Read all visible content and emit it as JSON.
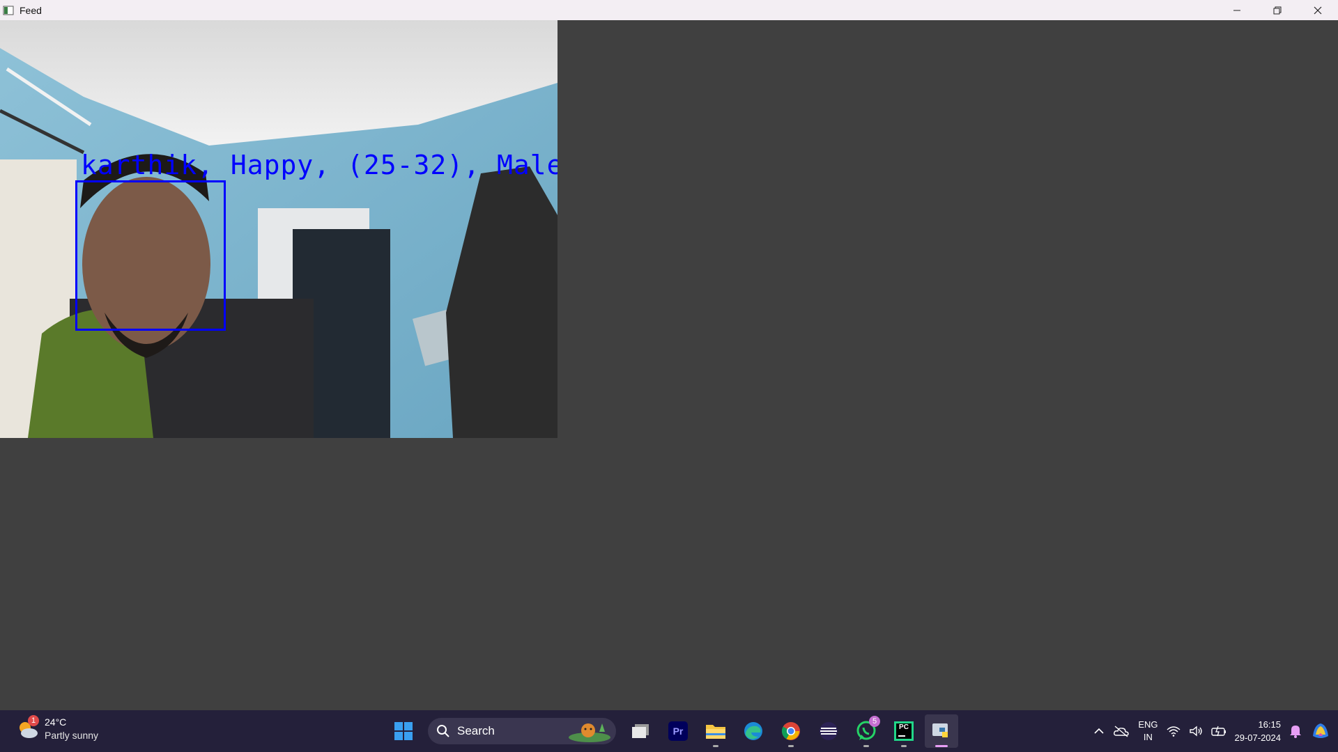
{
  "window": {
    "title": "Feed"
  },
  "feed": {
    "overlay_label": "karthik, Happy, (25-32), Male",
    "box_color": "#0000ff"
  },
  "taskbar": {
    "weather": {
      "temp": "24°C",
      "desc": "Partly sunny",
      "badge": "1"
    },
    "search": {
      "placeholder": "Search"
    },
    "apps": [
      {
        "name": "start-button",
        "icon": "windows-logo-icon"
      },
      {
        "name": "task-view",
        "icon": "task-view-icon"
      },
      {
        "name": "premiere-pro",
        "icon": "premiere-pro-icon",
        "label": "Pr"
      },
      {
        "name": "file-explorer",
        "icon": "folder-icon"
      },
      {
        "name": "edge",
        "icon": "edge-icon"
      },
      {
        "name": "chrome",
        "icon": "chrome-icon"
      },
      {
        "name": "app-stripes",
        "icon": "stripes-icon"
      },
      {
        "name": "whatsapp",
        "icon": "whatsapp-icon",
        "badge": "5"
      },
      {
        "name": "pycharm",
        "icon": "pycharm-icon",
        "label": "PC"
      },
      {
        "name": "python-feed",
        "icon": "python-icon"
      }
    ],
    "tray": {
      "lang_top": "ENG",
      "lang_bottom": "IN",
      "time": "16:15",
      "date": "29-07-2024"
    }
  }
}
